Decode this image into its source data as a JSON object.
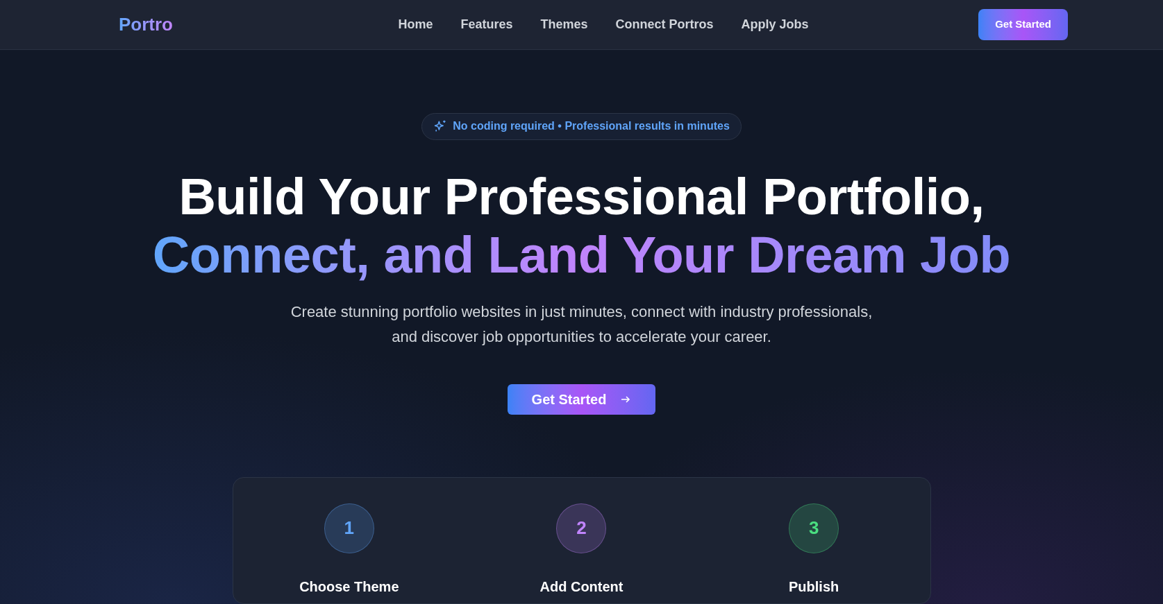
{
  "navbar": {
    "logo": "Portro",
    "links": [
      {
        "label": "Home"
      },
      {
        "label": "Features"
      },
      {
        "label": "Themes"
      },
      {
        "label": "Connect Portros"
      },
      {
        "label": "Apply Jobs"
      }
    ],
    "cta": "Get Started"
  },
  "hero": {
    "badge": "No coding required • Professional results in minutes",
    "headline_line_1": "Build Your Professional Portfolio,",
    "headline_line_2": "Connect, and Land Your Dream Job",
    "description": "Create stunning portfolio websites in just minutes, connect with industry professionals, and discover job opportunities to accelerate your career.",
    "button": "Get Started"
  },
  "steps": [
    {
      "number": "1",
      "label": "Choose Theme",
      "color": "#60a5fa"
    },
    {
      "number": "2",
      "label": "Add Content",
      "color": "#c084fc"
    },
    {
      "number": "3",
      "label": "Publish",
      "color": "#4ade80"
    }
  ]
}
